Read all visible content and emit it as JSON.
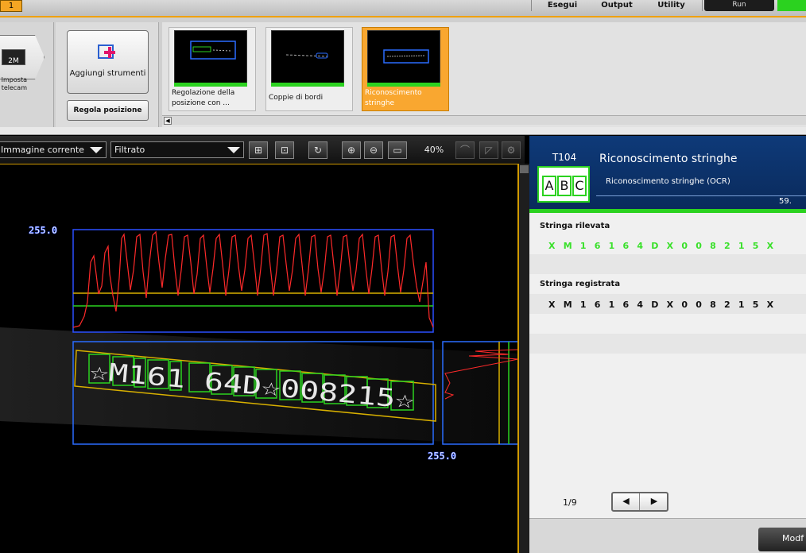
{
  "topbar": {
    "tab_label": "1",
    "menu": [
      "Esegui",
      "Output",
      "Utility"
    ],
    "run_label": "Run"
  },
  "camera": {
    "resolution": "2M",
    "label": "Imposta telecam"
  },
  "tools": {
    "add_label": "Aggiungi strumenti",
    "position_label": "Regola posizione"
  },
  "thumbnails": [
    {
      "label": "Regolazione della posizione con ..."
    },
    {
      "label": "Coppie di bordi"
    },
    {
      "label": "Riconoscimento stringhe",
      "selected": true
    }
  ],
  "viewer": {
    "image_select": "Immagine corrente",
    "filter_select": "Filtrato",
    "zoom": "40%",
    "scale_top": "255.0",
    "scale_bottom": "255.0",
    "ocr_text": "☆M161 64D☆008215☆"
  },
  "tool": {
    "id": "T104",
    "name": "Riconoscimento stringhe",
    "subtitle": "Riconoscimento stringhe (OCR)",
    "score": "59.",
    "icon_letters": [
      "A",
      "B",
      "C"
    ]
  },
  "result": {
    "detected_label": "Stringa rilevata",
    "detected_value": "X M 1 6 1 6 4 D X 0 0 8 2 1 5 X",
    "registered_label": "Stringa registrata",
    "registered_value": "X M 1 6 1 6 4 D X 0 0 8 2 1 5 X",
    "page": "1/9",
    "modify_label": "Modf"
  },
  "colors": {
    "accent": "#f9a730",
    "ok": "#2bd21f",
    "header": "#0e3a79"
  }
}
